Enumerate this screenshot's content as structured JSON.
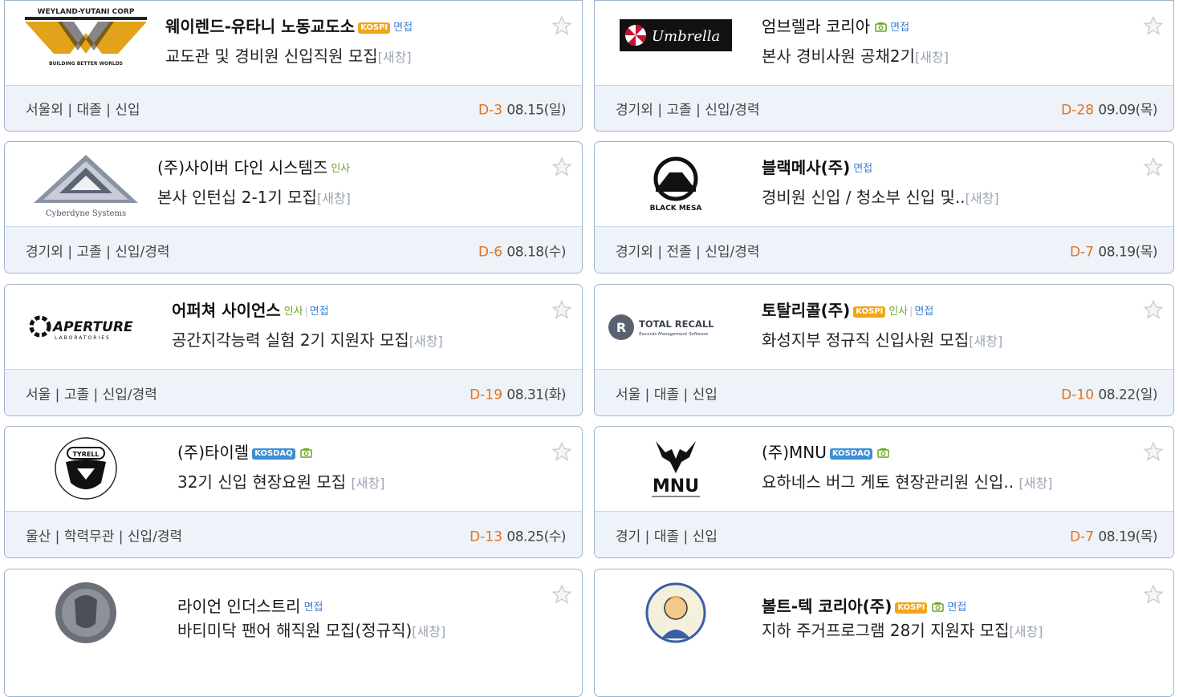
{
  "cards": [
    {
      "logo": "Weyland-Yutani Corp logo",
      "logo_text_top": "WEYLAND-YUTANI CORP",
      "logo_text_bottom": "BUILDING BETTER WORLDS",
      "company": "웨이렌드-유타니 노동교도소",
      "title": "교도관 및 경비원 신입직원 모집",
      "new_window": "[새창]",
      "tags": [
        "KOSPI",
        "면접"
      ],
      "location": "서울외 | 대졸 | 신입",
      "dday": "D-3",
      "date": "08.15(일)"
    },
    {
      "logo": "Umbrella logo",
      "logo_text": "Umbrella",
      "company": "엄브렐라 코리아",
      "title": "본사 경비사원 공채2기",
      "new_window": "[새창]",
      "tags": [
        "camera",
        "면접"
      ],
      "location": "경기외 | 고졸 | 신입/경력",
      "dday": "D-28",
      "date": "09.09(목)"
    },
    {
      "logo": "Cyberdyne Systems logo",
      "logo_text": "Cyberdyne Systems",
      "company": "(주)사이버 다인 시스템즈",
      "title": "본사 인턴십 2-1기 모집",
      "new_window": "[새창]",
      "tags": [
        "인사"
      ],
      "location": "경기외 | 고졸 | 신입/경력",
      "dday": "D-6",
      "date": "08.18(수)"
    },
    {
      "logo": "Black Mesa logo",
      "logo_text": "BLACK MESA",
      "company": "블랙메사(주)",
      "title": "경비원 신입 / 청소부 신입 및..",
      "new_window": "[새창]",
      "tags": [
        "면접"
      ],
      "location": "경기외 | 전졸 | 신입/경력",
      "dday": "D-7",
      "date": "08.19(목)"
    },
    {
      "logo": "Aperture Laboratories logo",
      "logo_text": "APERTURE",
      "logo_sub": "LABORATORIES",
      "company": "어퍼쳐 사이언스",
      "title": "공간지각능력 실험 2기 지원자 모집",
      "new_window": "[새창]",
      "tags": [
        "인사",
        "면접"
      ],
      "location": "서울 | 고졸 | 신입/경력",
      "dday": "D-19",
      "date": "08.31(화)"
    },
    {
      "logo": "Total Recall logo",
      "logo_text": "TOTAL RECALL",
      "logo_sub": "Records Management Software",
      "company": "토탈리콜(주)",
      "title": "화성지부 정규직 신입사원 모집",
      "new_window": "[새창]",
      "tags": [
        "KOSPI",
        "인사",
        "면접"
      ],
      "location": "서울 | 대졸 | 신입",
      "dday": "D-10",
      "date": "08.22(일)"
    },
    {
      "logo": "Tyrell Corporation logo",
      "logo_text": "TYRELL",
      "company": "(주)타이렐",
      "title": "32기 신입 현장요원 모집",
      "new_window": "[새창]",
      "tags": [
        "KOSDAQ",
        "camera"
      ],
      "location": "울산 | 학력무관 | 신입/경력",
      "dday": "D-13",
      "date": "08.25(수)"
    },
    {
      "logo": "MNU logo",
      "logo_text": "MNU",
      "company": "(주)MNU",
      "title": "요하네스 버그 게토 현장관리원 신입..",
      "new_window": "[새창]",
      "tags": [
        "KOSDAQ",
        "camera"
      ],
      "location": "경기 | 대졸 | 신입",
      "dday": "D-7",
      "date": "08.19(목)"
    },
    {
      "logo": "Ryan Industries logo",
      "company": "라이언 인더스트리",
      "title": "바티미닥 팬어 해직원 모집(정규직)",
      "new_window": "[새창]",
      "tags": [
        "면접"
      ]
    },
    {
      "logo": "Vault-Tec logo",
      "company": "볼트-텍 코리아(주)",
      "title": "지하 주거프로그램 28기 지원자 모집",
      "new_window": "[새창]",
      "tags": [
        "KOSPI",
        "camera",
        "면접"
      ]
    }
  ],
  "tag_labels": {
    "kospi": "KOSPI",
    "kosdaq": "KOSDAQ",
    "insa": "인사",
    "myeon": "면접"
  },
  "colors": {
    "border": "#9fb4cf",
    "footer_bg": "#eef2f9",
    "dday": "#e3721c",
    "kospi": "#f0a51a",
    "kosdaq": "#3c8fd6",
    "insa": "#6aa61e",
    "myeon": "#3b7fd1",
    "new_window": "#9aa3b3"
  }
}
